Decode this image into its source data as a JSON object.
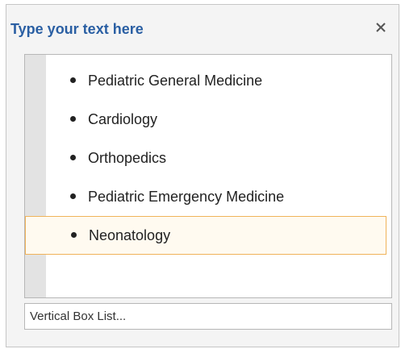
{
  "pane": {
    "title": "Type your text here",
    "close_icon": "close-icon"
  },
  "list": {
    "items": [
      {
        "label": "Pediatric General Medicine",
        "selected": false
      },
      {
        "label": "Cardiology",
        "selected": false
      },
      {
        "label": "Orthopedics",
        "selected": false
      },
      {
        "label": "Pediatric Emergency Medicine",
        "selected": false
      },
      {
        "label": "Neonatology",
        "selected": true
      }
    ]
  },
  "footer": {
    "label": "Vertical Box List..."
  },
  "colors": {
    "title": "#2a5fa3",
    "selection_border": "#f0b35a",
    "gutter": "#e3e3e3"
  }
}
